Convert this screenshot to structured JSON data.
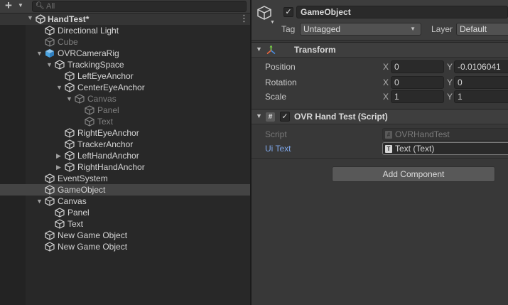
{
  "hierarchy": {
    "search_placeholder": "All",
    "scene_name": "HandTest*",
    "items": [
      {
        "label": "Directional Light",
        "depth": 0,
        "fold": "",
        "icon": "gameobject-icon",
        "dim": false,
        "selected": false
      },
      {
        "label": "Cube",
        "depth": 0,
        "fold": "",
        "icon": "gameobject-icon",
        "dim": true,
        "selected": false
      },
      {
        "label": "OVRCameraRig",
        "depth": 0,
        "fold": "open",
        "icon": "prefab-icon",
        "dim": false,
        "selected": false
      },
      {
        "label": "TrackingSpace",
        "depth": 1,
        "fold": "open",
        "icon": "gameobject-icon",
        "dim": false,
        "selected": false
      },
      {
        "label": "LeftEyeAnchor",
        "depth": 2,
        "fold": "",
        "icon": "gameobject-icon",
        "dim": false,
        "selected": false
      },
      {
        "label": "CenterEyeAnchor",
        "depth": 2,
        "fold": "open",
        "icon": "gameobject-icon",
        "dim": false,
        "selected": false
      },
      {
        "label": "Canvas",
        "depth": 3,
        "fold": "open",
        "icon": "gameobject-icon",
        "dim": true,
        "selected": false
      },
      {
        "label": "Panel",
        "depth": 4,
        "fold": "",
        "icon": "gameobject-icon",
        "dim": true,
        "selected": false
      },
      {
        "label": "Text",
        "depth": 4,
        "fold": "",
        "icon": "gameobject-icon",
        "dim": true,
        "selected": false
      },
      {
        "label": "RightEyeAnchor",
        "depth": 2,
        "fold": "",
        "icon": "gameobject-icon",
        "dim": false,
        "selected": false
      },
      {
        "label": "TrackerAnchor",
        "depth": 2,
        "fold": "",
        "icon": "gameobject-icon",
        "dim": false,
        "selected": false
      },
      {
        "label": "LeftHandAnchor",
        "depth": 2,
        "fold": "closed",
        "icon": "gameobject-icon",
        "dim": false,
        "selected": false
      },
      {
        "label": "RightHandAnchor",
        "depth": 2,
        "fold": "closed",
        "icon": "gameobject-icon",
        "dim": false,
        "selected": false
      },
      {
        "label": "EventSystem",
        "depth": 0,
        "fold": "",
        "icon": "gameobject-icon",
        "dim": false,
        "selected": false
      },
      {
        "label": "GameObject",
        "depth": 0,
        "fold": "",
        "icon": "gameobject-icon",
        "dim": false,
        "selected": true
      },
      {
        "label": "Canvas",
        "depth": 0,
        "fold": "open",
        "icon": "gameobject-icon",
        "dim": false,
        "selected": false
      },
      {
        "label": "Panel",
        "depth": 1,
        "fold": "",
        "icon": "gameobject-icon",
        "dim": false,
        "selected": false
      },
      {
        "label": "Text",
        "depth": 1,
        "fold": "",
        "icon": "gameobject-icon",
        "dim": false,
        "selected": false
      },
      {
        "label": "New Game Object",
        "depth": 0,
        "fold": "",
        "icon": "gameobject-icon",
        "dim": false,
        "selected": false
      },
      {
        "label": "New Game Object",
        "depth": 0,
        "fold": "",
        "icon": "gameobject-icon",
        "dim": false,
        "selected": false
      }
    ]
  },
  "inspector": {
    "object_name": "GameObject",
    "tag_label": "Tag",
    "tag_value": "Untagged",
    "layer_label": "Layer",
    "layer_value": "Default",
    "transform": {
      "title": "Transform",
      "rows": [
        {
          "label": "Position",
          "x_axis": "X",
          "x": "0",
          "y_axis": "Y",
          "y": "-0.0106041"
        },
        {
          "label": "Rotation",
          "x_axis": "X",
          "x": "0",
          "y_axis": "Y",
          "y": "0"
        },
        {
          "label": "Scale",
          "x_axis": "X",
          "x": "1",
          "y_axis": "Y",
          "y": "1"
        }
      ]
    },
    "script_component": {
      "title": "OVR Hand Test (Script)",
      "script_label": "Script",
      "script_value": "OVRHandTest",
      "uitext_label": "Ui Text",
      "uitext_value": "Text (Text)"
    },
    "add_component_label": "Add Component"
  },
  "colors": {
    "selection_row": "#444444",
    "link_label": "#7ea6e8",
    "prefab_blue": "#4aa3df"
  }
}
